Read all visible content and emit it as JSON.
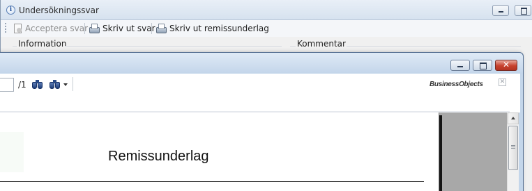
{
  "back_window": {
    "title": "Undersökningssvar",
    "icon": "info-icon",
    "toolbar": {
      "accept": {
        "label": "Acceptera svar",
        "icon": "accept-doc-icon",
        "enabled": false
      },
      "print_answer": {
        "label": "Skriv ut svar",
        "icon": "printer-icon"
      },
      "print_referral": {
        "label": "Skriv ut remissunderlag",
        "icon": "printer-icon"
      }
    },
    "groups": {
      "information": "Information",
      "comment": "Kommentar"
    }
  },
  "viewer_window": {
    "toolbar": {
      "page_input": "",
      "page_total": "/1",
      "find_icon": "binoculars-icon",
      "advanced_find_icon": "binoculars-plus-icon",
      "logo": {
        "first": "Business",
        "second": "Objects"
      }
    },
    "report": {
      "title": "Remissunderlag"
    }
  },
  "colors": {
    "close_button": "#c7412e",
    "title_bar": "#d6e2ef",
    "canvas": "#a8a8a8"
  }
}
